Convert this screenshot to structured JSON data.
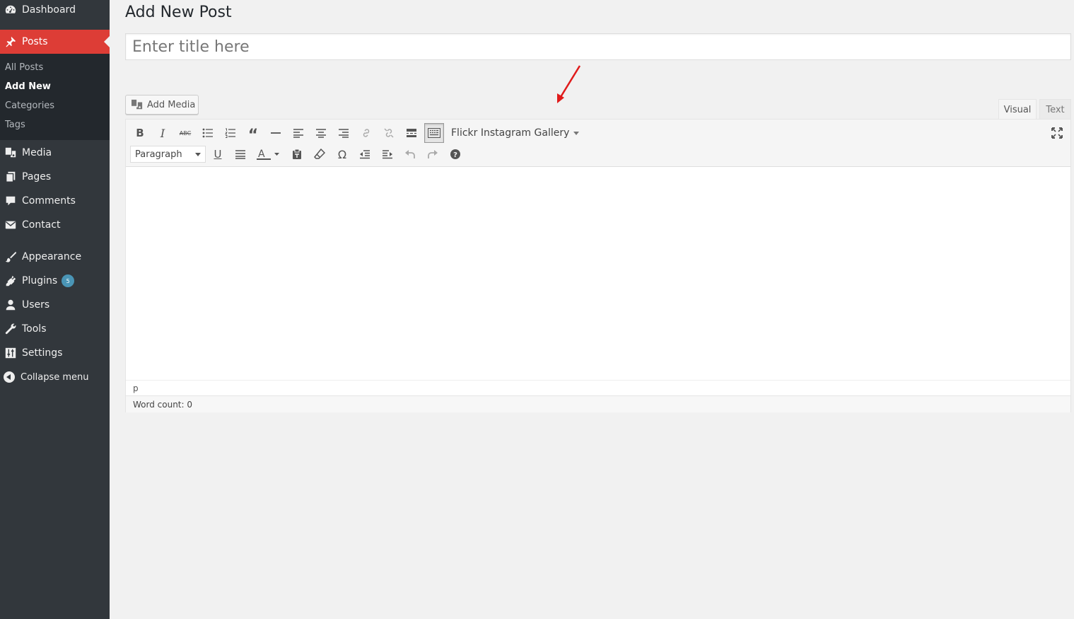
{
  "sidebar": {
    "dashboard": "Dashboard",
    "posts": "Posts",
    "submenu": {
      "all_posts": "All Posts",
      "add_new": "Add New",
      "categories": "Categories",
      "tags": "Tags"
    },
    "media": "Media",
    "pages": "Pages",
    "comments": "Comments",
    "contact": "Contact",
    "appearance": "Appearance",
    "plugins": "Plugins",
    "plugins_badge": "5",
    "users": "Users",
    "tools": "Tools",
    "settings": "Settings",
    "collapse": "Collapse menu"
  },
  "main": {
    "page_title": "Add New Post",
    "title_placeholder": "Enter title here",
    "add_media": "Add Media",
    "tabs": {
      "visual": "Visual",
      "text": "Text"
    },
    "plugin_button": "Flickr Instagram Gallery",
    "format_select": "Paragraph",
    "status_path": "p",
    "word_count": "Word count: 0"
  },
  "colors": {
    "sidebar_bg": "#32373c",
    "submenu_bg": "#23282d",
    "accent": "#dd3d36",
    "badge": "#4a95b6",
    "annotation_arrow": "#e01b1b"
  }
}
